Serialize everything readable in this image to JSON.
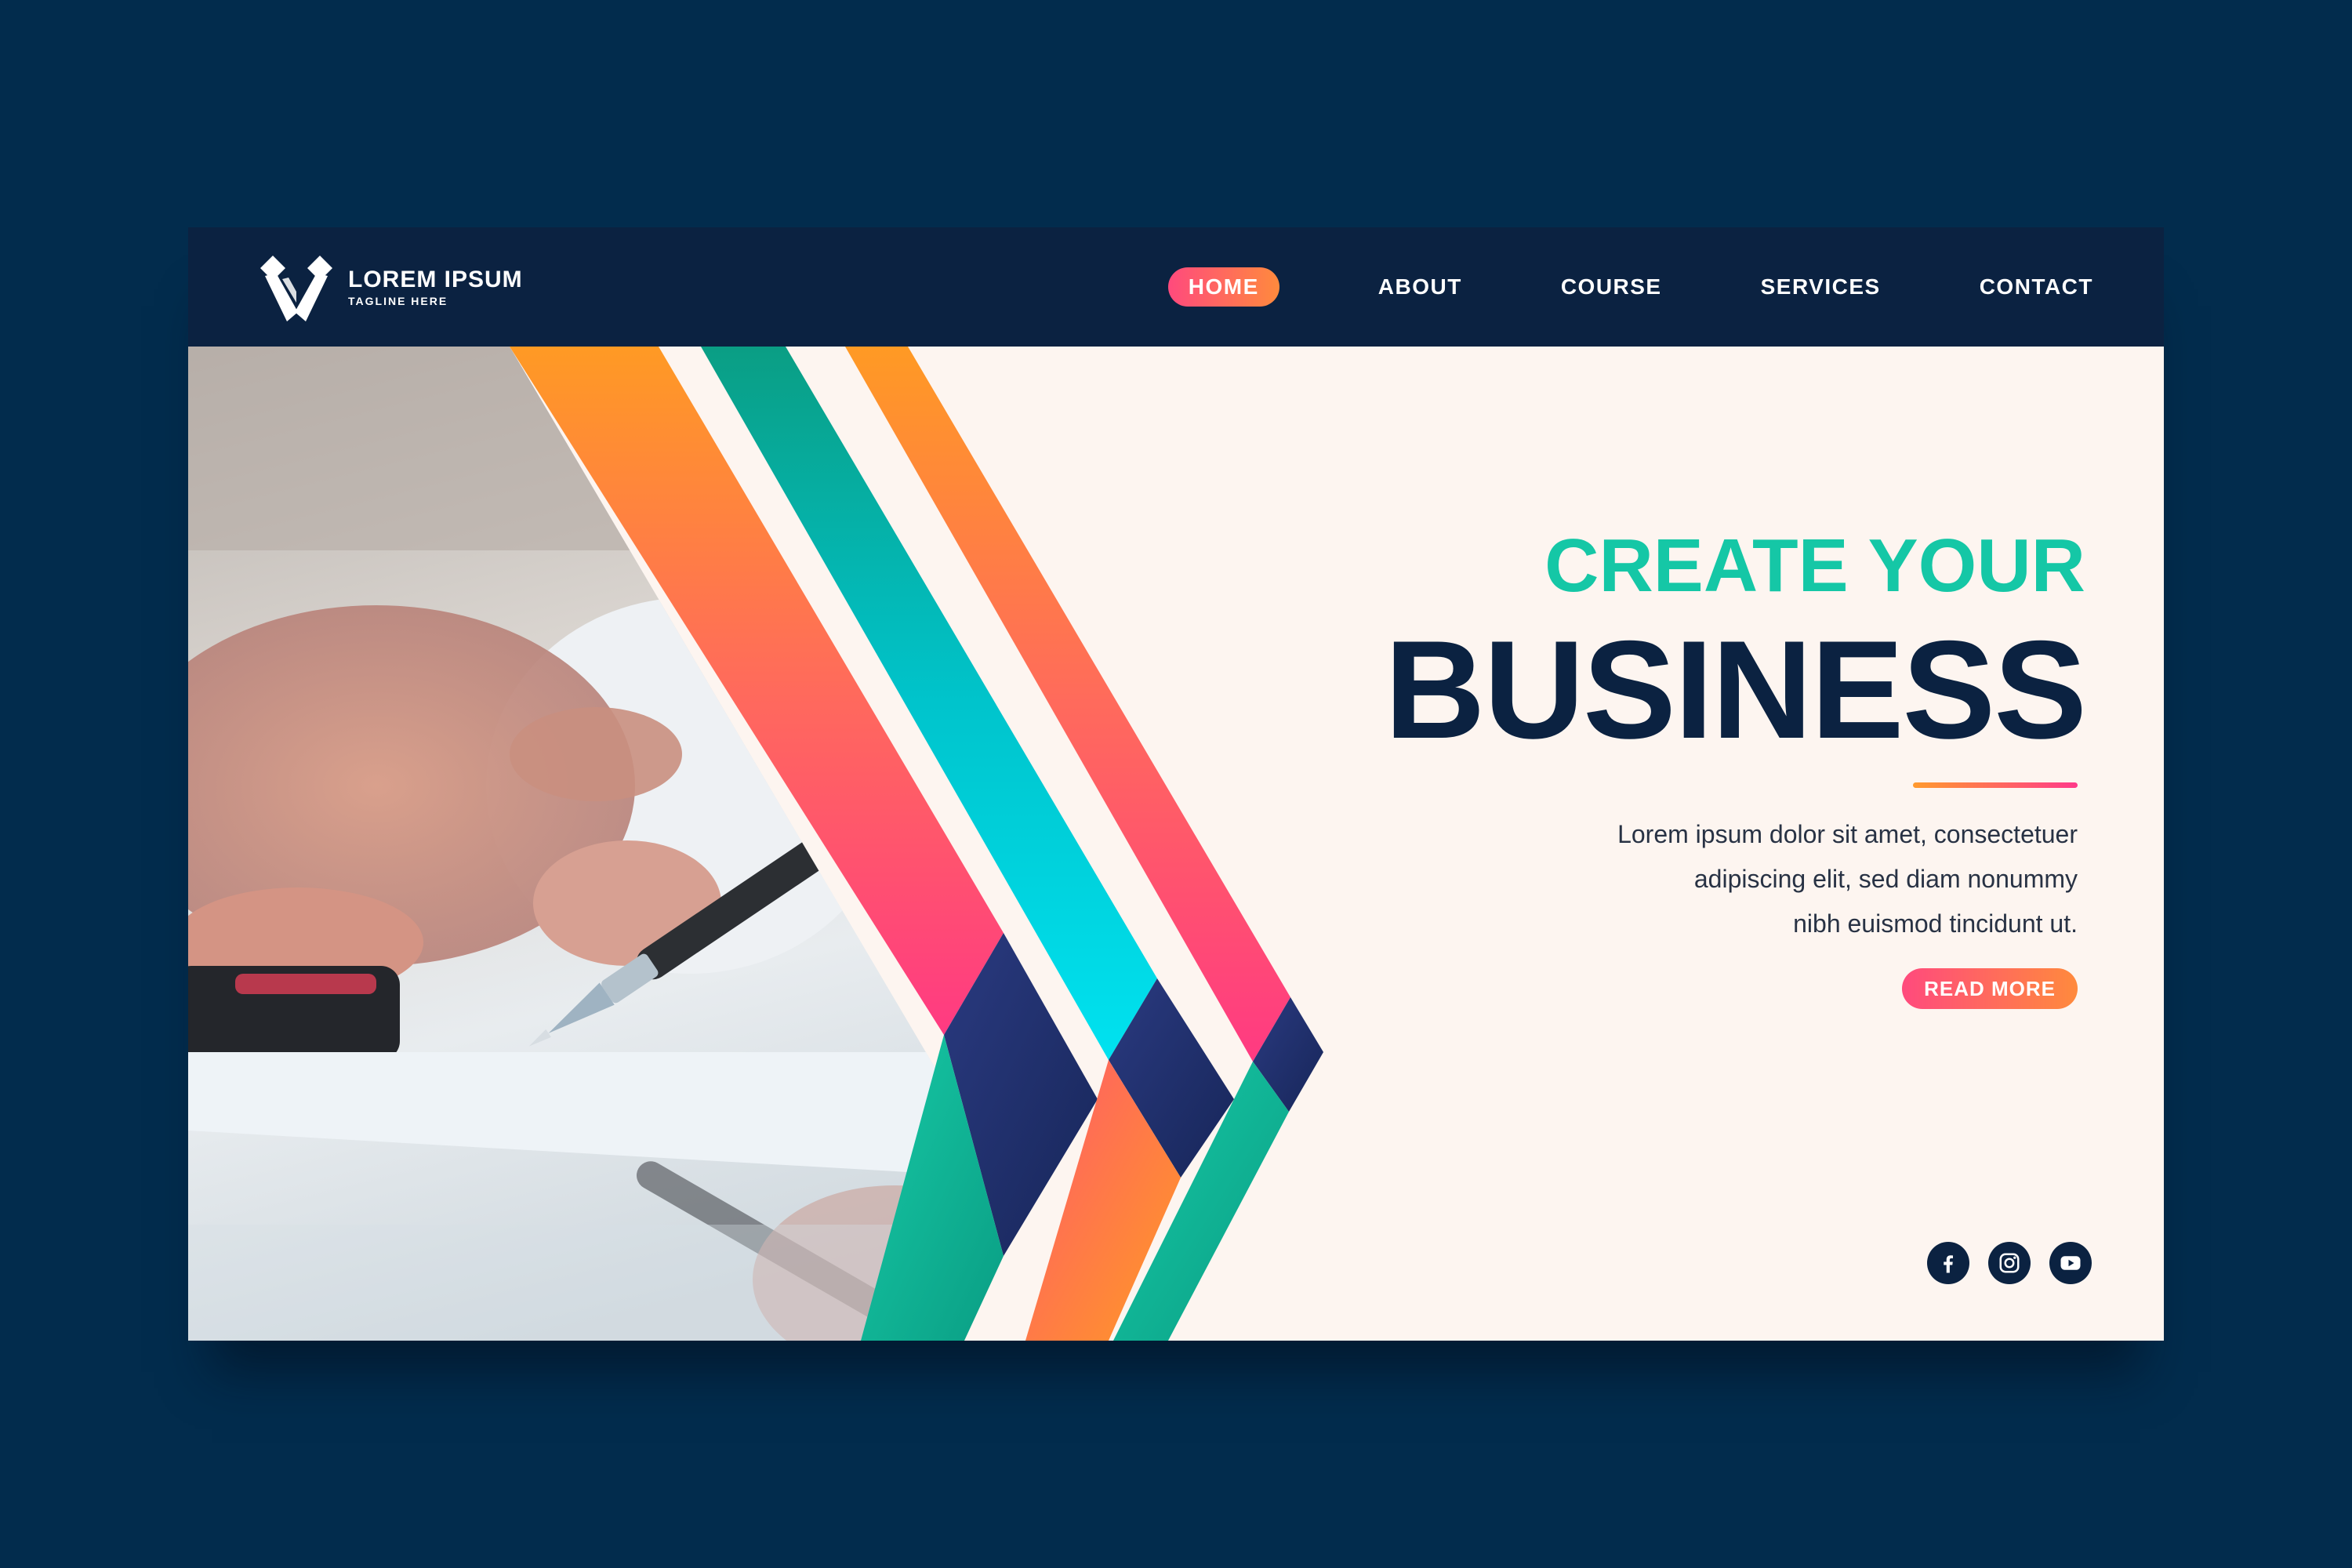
{
  "brand": {
    "name": "LOREM IPSUM",
    "tagline": "TAGLINE HERE",
    "logo_icon": "v-chevron-logo-icon"
  },
  "nav": {
    "items": [
      {
        "label": "HOME",
        "active": true
      },
      {
        "label": "ABOUT",
        "active": false
      },
      {
        "label": "COURSE",
        "active": false
      },
      {
        "label": "SERVICES",
        "active": false
      },
      {
        "label": "CONTACT",
        "active": false
      }
    ]
  },
  "hero": {
    "kicker": "CREATE YOUR",
    "title": "BUSINESS",
    "body_lines": [
      "Lorem ipsum dolor sit amet, consectetuer",
      "adipiscing elit, sed diam nonummy",
      "nibh euismod tincidunt ut."
    ],
    "cta_label": "READ MORE"
  },
  "socials": [
    {
      "icon": "facebook-icon"
    },
    {
      "icon": "instagram-icon"
    },
    {
      "icon": "youtube-icon"
    }
  ],
  "colors": {
    "page_background": "#022c4d",
    "navbar": "#0b2241",
    "hero_background": "#fdf5f0",
    "accent_teal": "#15c7a6",
    "accent_pink": "#ff4a7d",
    "accent_orange": "#ff8a3d",
    "accent_cyan": "#00dcec",
    "accent_navy": "#1f2f6e"
  }
}
